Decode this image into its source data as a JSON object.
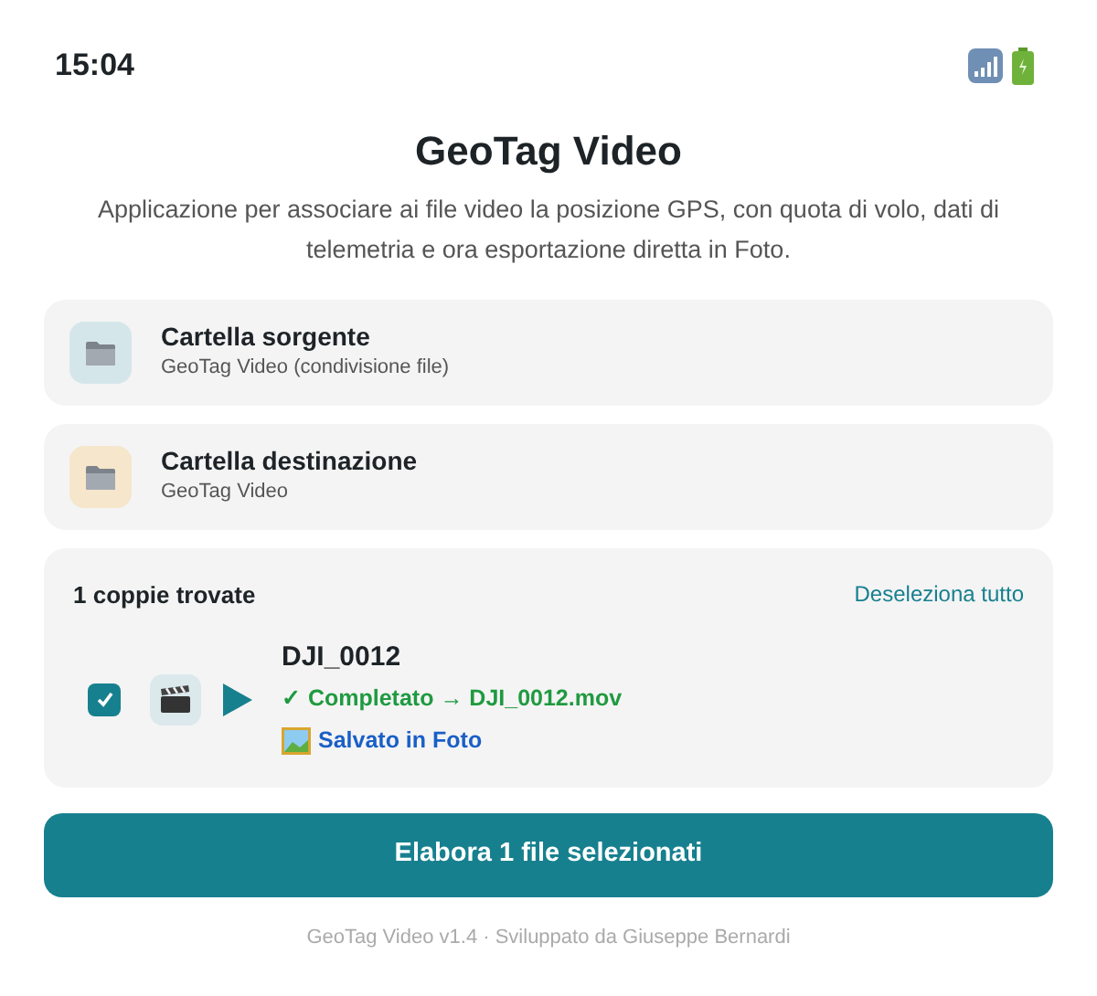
{
  "status_bar": {
    "time": "15:04"
  },
  "title": "GeoTag Video",
  "description": "Applicazione per associare ai file video la posizione GPS, con quota di volo, dati di telemetria e ora esportazione diretta in Foto.",
  "folders": [
    {
      "label": "Cartella sorgente",
      "subtitle": "GeoTag Video (condivisione file)",
      "color": "#d5e6ea"
    },
    {
      "label": "Cartella destinazione",
      "subtitle": "GeoTag Video",
      "color": "#f5e6cc"
    }
  ],
  "pairs": {
    "count_label": "1 coppie trovate",
    "deselect_link": "Deseleziona tutto",
    "items": [
      {
        "name": "DJI_0012",
        "checked": true,
        "status": "✓ Completato → DJI_0012.mov",
        "saved": "Salvato in Foto"
      }
    ]
  },
  "process_button": "Elabora 1 file selezionati",
  "footer": "GeoTag Video v1.4 · Sviluppato da Giuseppe Bernardi"
}
